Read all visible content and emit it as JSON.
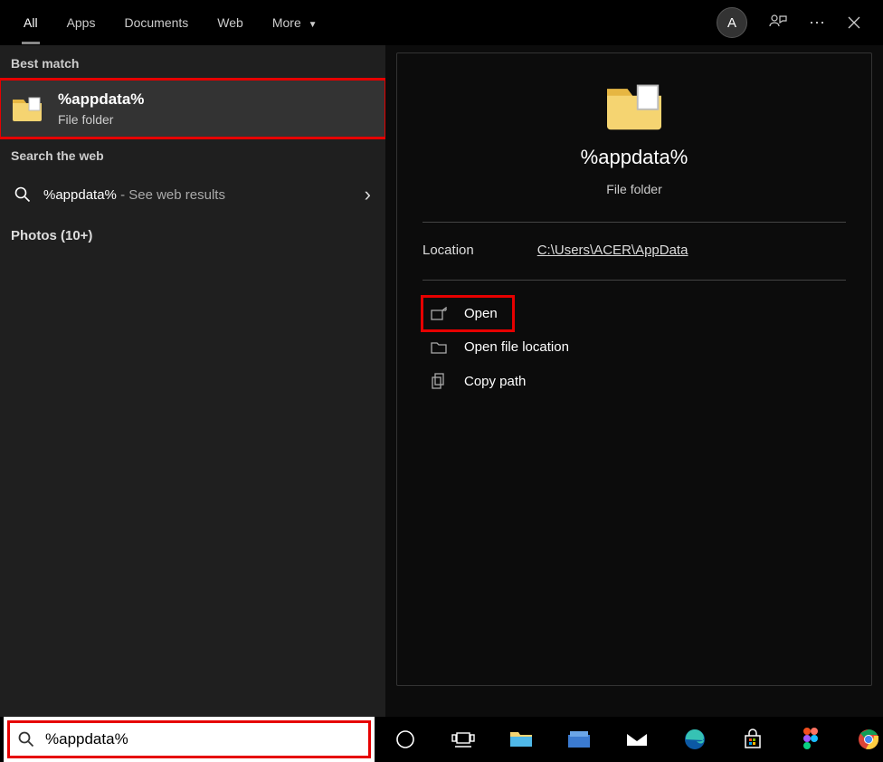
{
  "header": {
    "tabs": [
      "All",
      "Apps",
      "Documents",
      "Web",
      "More"
    ],
    "avatar_letter": "A"
  },
  "left": {
    "best_match_label": "Best match",
    "best_match": {
      "title": "%appdata%",
      "subtitle": "File folder"
    },
    "web_label": "Search the web",
    "web_query": "%appdata%",
    "web_suffix": " - See web results",
    "photos_label": "Photos (10+)"
  },
  "preview": {
    "title": "%appdata%",
    "subtitle": "File folder",
    "location_label": "Location",
    "location_path": "C:\\Users\\ACER\\AppData",
    "actions": {
      "open": "Open",
      "open_file_location": "Open file location",
      "copy_path": "Copy path"
    }
  },
  "search": {
    "value": "%appdata%"
  }
}
